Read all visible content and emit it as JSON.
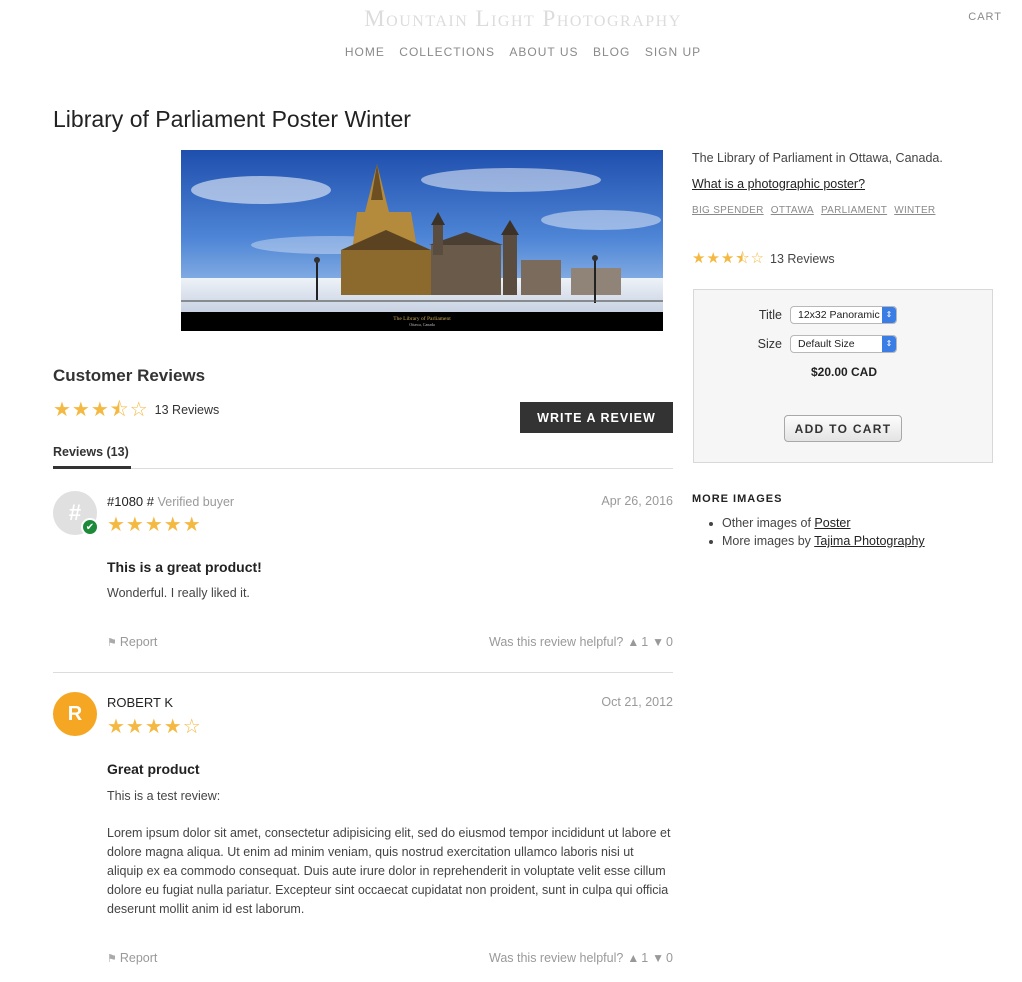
{
  "header": {
    "site_title": "Mountain Light Photography",
    "cart_label": "CART",
    "nav": [
      "HOME",
      "COLLECTIONS",
      "ABOUT US",
      "BLOG",
      "SIGN UP"
    ]
  },
  "product": {
    "title": "Library of Parliament Poster Winter",
    "image_caption_title": "The Library of Parliament",
    "image_caption_sub": "Ottawa, Canada",
    "description": "The Library of Parliament in Ottawa, Canada.",
    "poster_link": "What is a photographic poster?",
    "tags": [
      "BIG SPENDER",
      "OTTAWA",
      "PARLIAMENT",
      "WINTER"
    ],
    "rating_stars": 3.5,
    "rating_count_label": "13 Reviews",
    "options": {
      "title_label": "Title",
      "title_value": "12x32 Panoramic",
      "size_label": "Size",
      "size_value": "Default Size"
    },
    "price": "$20.00 CAD",
    "add_to_cart": "ADD TO CART"
  },
  "more_images": {
    "heading": "MORE IMAGES",
    "items": [
      {
        "prefix": "Other images of ",
        "link": "Poster"
      },
      {
        "prefix": "More images by ",
        "link": "Tajima Photography"
      }
    ]
  },
  "reviews": {
    "heading": "Customer Reviews",
    "summary_stars": 3.5,
    "summary_count": "13 Reviews",
    "write_button": "WRITE A REVIEW",
    "tab_label": "Reviews (13)",
    "items": [
      {
        "avatar": "#",
        "name": "#1080 #",
        "verified": "Verified buyer",
        "date": "Apr 26, 2016",
        "stars": 5,
        "title": "This is a great product!",
        "body": "Wonderful. I really liked it.",
        "report": "Report",
        "helpful_label": "Was this review helpful?",
        "up": "1",
        "down": "0"
      },
      {
        "avatar": "R",
        "name": "ROBERT K",
        "verified": "",
        "date": "Oct 21, 2012",
        "stars": 4,
        "title": "Great product",
        "body_intro": "This is a test review:",
        "body": "Lorem ipsum dolor sit amet, consectetur adipisicing elit, sed do eiusmod tempor incididunt ut labore et dolore magna aliqua. Ut enim ad minim veniam, quis nostrud exercitation ullamco laboris nisi ut aliquip ex ea commodo consequat. Duis aute irure dolor in reprehenderit in voluptate velit esse cillum dolore eu fugiat nulla pariatur. Excepteur sint occaecat cupidatat non proident, sunt in culpa qui officia deserunt mollit anim id est laborum.",
        "report": "Report",
        "helpful_label": "Was this review helpful?",
        "up": "1",
        "down": "0"
      }
    ]
  },
  "colors": {
    "star": "#f4b942",
    "button_dark": "#333333",
    "verified_green": "#1d8a3a",
    "avatar_orange": "#f5a623",
    "select_accent": "#3a7de4"
  },
  "icons": [
    "flag-icon",
    "thumbs-up-icon",
    "thumbs-down-icon",
    "check-icon",
    "chevron-updown-icon"
  ]
}
